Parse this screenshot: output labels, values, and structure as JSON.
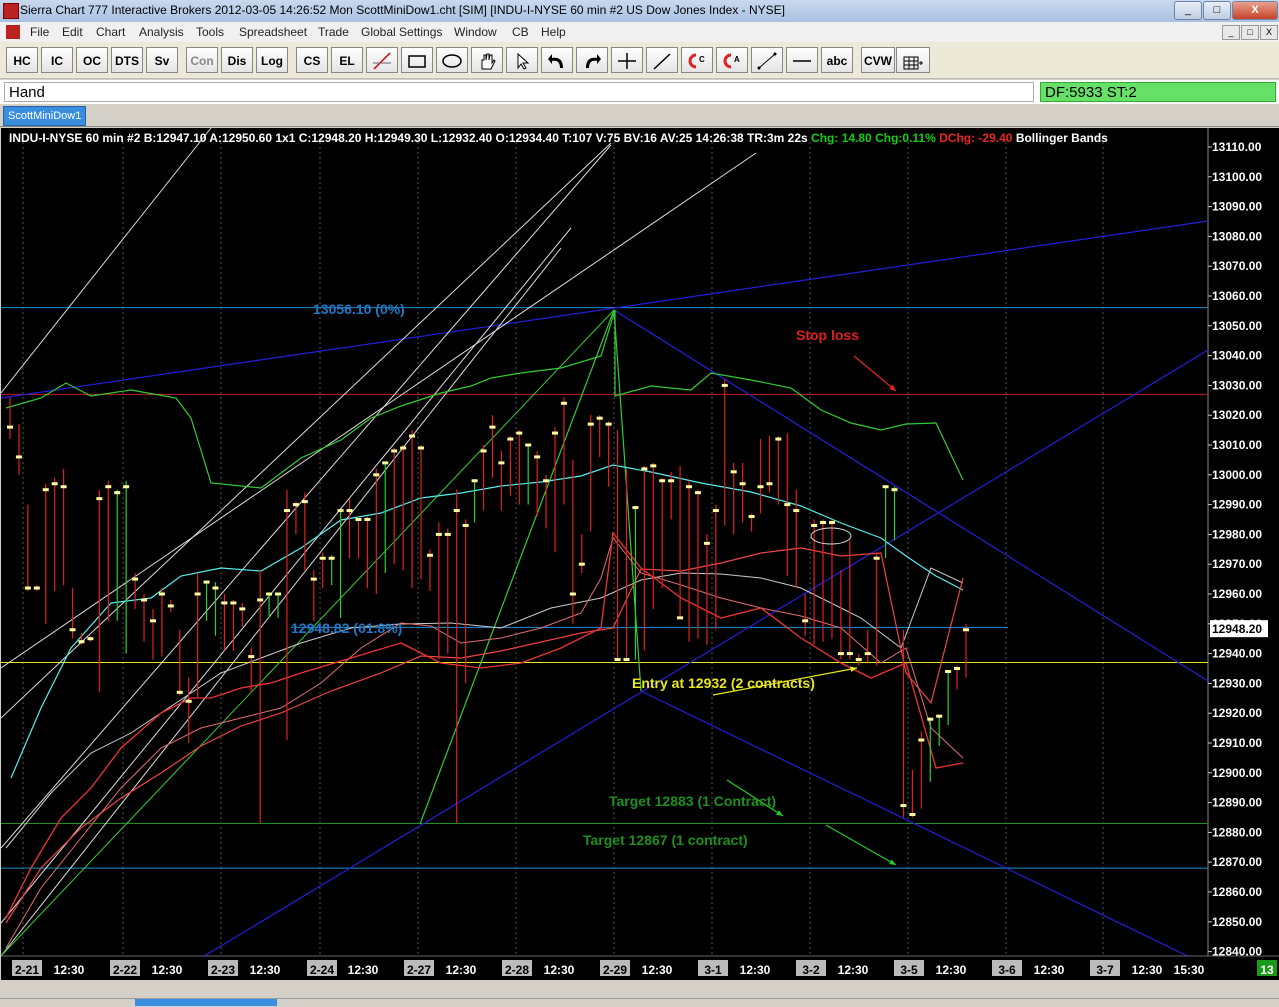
{
  "window": {
    "title": "Sierra Chart 777 Interactive Brokers 2012-03-05  14:26:52 Mon  ScottMiniDow1.cht [SIM]  [INDU-I-NYSE  60 min  #2  US Dow Jones Index - NYSE]",
    "min": "_",
    "max": "□",
    "close": "X"
  },
  "menu": [
    "File",
    "Edit",
    "Chart",
    "Analysis",
    "Tools",
    "Spreadsheet",
    "Trade",
    "Global Settings",
    "Window",
    "CB",
    "Help"
  ],
  "mdi_controls": [
    "_",
    "□",
    "X"
  ],
  "toolbar": [
    {
      "label": "HC",
      "icon": ""
    },
    {
      "label": "IC",
      "icon": ""
    },
    {
      "label": "OC",
      "icon": ""
    },
    {
      "label": "DTS",
      "icon": ""
    },
    {
      "label": "Sv",
      "icon": ""
    },
    {
      "label": "Con",
      "icon": ""
    },
    {
      "label": "Dis",
      "icon": ""
    },
    {
      "label": "Log",
      "icon": ""
    },
    {
      "label": "CS",
      "icon": ""
    },
    {
      "label": "EL",
      "icon": ""
    },
    {
      "label": "",
      "icon": "trendline-icon"
    },
    {
      "label": "",
      "icon": "rectangle-icon"
    },
    {
      "label": "",
      "icon": "ellipse-icon"
    },
    {
      "label": "",
      "icon": "hand-icon"
    },
    {
      "label": "",
      "icon": "pointer-icon"
    },
    {
      "label": "",
      "icon": "undo-arrow-icon"
    },
    {
      "label": "",
      "icon": "redo-arrow-icon"
    },
    {
      "label": "",
      "icon": "crosshair-icon"
    },
    {
      "label": "",
      "icon": "ray-icon"
    },
    {
      "label": "",
      "icon": "magnet-c-icon"
    },
    {
      "label": "",
      "icon": "magnet-a-icon"
    },
    {
      "label": "",
      "icon": "line-icon"
    },
    {
      "label": "",
      "icon": "horizontal-line-icon"
    },
    {
      "label": "abc",
      "icon": ""
    },
    {
      "label": "CVW",
      "icon": ""
    },
    {
      "label": "",
      "icon": "tvw-grid-icon"
    }
  ],
  "tool_mode": "Hand",
  "status_box": "DF:5933  ST:2",
  "chart_tab": "ScottMiniDow1",
  "info": {
    "symbol": "INDU-I-NYSE  60 min   #2 B:12947.10 A:12950.60 1x1 C:12948.20 H:12949.30 L:12932.40 O:12934.40 T:107 V:75 BV:16 AV:25 14:26:38 TR:3m 22s",
    "chg": "Chg: 14.80 Chg:0.11%",
    "dchg": "DChg: -29.40",
    "study": "Bollinger Bands"
  },
  "annotations": {
    "fib0": "13056.10 (0%)",
    "fib618": "12948.82 (61.8%)",
    "stop": "Stop loss",
    "entry": "Entry at 12932 (2 contracts)",
    "target1": "Target 12883 (1 Contract)",
    "target2": "Target 12867 (1 contract)"
  },
  "colors": {
    "background": "#000000",
    "up_bar": "#2ecc2e",
    "down_bar": "#e02020",
    "price_label": "#ffffff",
    "fib_line": "#1e90d0",
    "stop_line": "#c02020",
    "entry_line": "#e8e820",
    "target_line": "#1f8f1f",
    "trend_line": "#2020d8"
  },
  "price_axis": {
    "ticks": [
      "13110.00",
      "13100.00",
      "13090.00",
      "13080.00",
      "13070.00",
      "13060.00",
      "13050.00",
      "13040.00",
      "13030.00",
      "13020.00",
      "13010.00",
      "13000.00",
      "12990.00",
      "12980.00",
      "12970.00",
      "12960.00",
      "12950.00",
      "12940.00",
      "12930.00",
      "12920.00",
      "12910.00",
      "12900.00",
      "12890.00",
      "12880.00",
      "12870.00",
      "12860.00",
      "12850.00",
      "12840.00"
    ],
    "last_price": "12948.20"
  },
  "time_axis": {
    "labels": [
      {
        "text": "2-21",
        "date": true
      },
      {
        "text": "12:30",
        "date": false
      },
      {
        "text": "2-22",
        "date": true
      },
      {
        "text": "12:30",
        "date": false
      },
      {
        "text": "2-23",
        "date": true
      },
      {
        "text": "12:30",
        "date": false
      },
      {
        "text": "2-24",
        "date": true
      },
      {
        "text": "12:30",
        "date": false
      },
      {
        "text": "2-27",
        "date": true
      },
      {
        "text": "12:30",
        "date": false
      },
      {
        "text": "2-28",
        "date": true
      },
      {
        "text": "12:30",
        "date": false
      },
      {
        "text": "2-29",
        "date": true
      },
      {
        "text": "12:30",
        "date": false
      },
      {
        "text": "3-1",
        "date": true
      },
      {
        "text": "12:30",
        "date": false
      },
      {
        "text": "3-2",
        "date": true
      },
      {
        "text": "12:30",
        "date": false
      },
      {
        "text": "3-5",
        "date": true
      },
      {
        "text": "12:30",
        "date": false
      },
      {
        "text": "3-6",
        "date": true
      },
      {
        "text": "12:30",
        "date": false
      },
      {
        "text": "3-7",
        "date": true
      },
      {
        "text": "12:30",
        "date": false
      },
      {
        "text": "15:30",
        "date": false
      }
    ],
    "counter": "13"
  },
  "levels": {
    "fib0": 13056.1,
    "stop": 13027,
    "fib618": 12948.82,
    "entry": 12937,
    "target1": 12883,
    "target2": 12868
  },
  "bars": [
    [
      13026,
      13012,
      13024,
      13016
    ],
    [
      13017,
      13000,
      13016,
      13006
    ],
    [
      12990,
      12961,
      12988,
      12962
    ],
    [
      12963,
      12961,
      12962,
      12962
    ],
    [
      12997,
      12950,
      12994,
      12995
    ],
    [
      12999,
      12961,
      12996,
      12997
    ],
    [
      13002,
      12963,
      12995,
      12996
    ],
    [
      12962,
      12945,
      12961,
      12948
    ],
    [
      12947,
      12943,
      12946,
      12944
    ],
    [
      12946,
      12944,
      12945,
      12945
    ],
    [
      12995,
      12927,
      12988,
      12992
    ],
    [
      12998,
      12951,
      12995,
      12996
    ],
    [
      12992,
      12951,
      12995,
      12994
    ],
    [
      12994,
      12940,
      12998,
      12996
    ],
    [
      12967,
      12955,
      12965,
      12965
    ],
    [
      12960,
      12944,
      12959,
      12958
    ],
    [
      12955,
      12938,
      12952,
      12951
    ],
    [
      12962,
      12939,
      12960,
      12960
    ],
    [
      12958,
      12954,
      12957,
      12956
    ],
    [
      12948,
      12926,
      12946,
      12927
    ],
    [
      12932,
      12910,
      12928,
      12924
    ],
    [
      12967,
      12925,
      12950,
      12960
    ],
    [
      12963,
      12951,
      12963,
      12964
    ],
    [
      12962,
      12946,
      12964,
      12962
    ],
    [
      12960,
      12941,
      12959,
      12957
    ],
    [
      12958,
      12941,
      12957,
      12957
    ],
    [
      12957,
      12949,
      12956,
      12955
    ],
    [
      12942,
      12927,
      12940,
      12939
    ],
    [
      12968,
      12883,
      12932,
      12958
    ],
    [
      12960,
      12952,
      12959,
      12960
    ],
    [
      12959,
      12952,
      12960,
      12960
    ],
    [
      12995,
      12911,
      12958,
      12988
    ],
    [
      12991,
      12980,
      12988,
      12990
    ],
    [
      12994,
      12968,
      12993,
      12991
    ],
    [
      12968,
      12951,
      12966,
      12965
    ],
    [
      12974,
      12962,
      12970,
      12972
    ],
    [
      12971,
      12963,
      12973,
      12972
    ],
    [
      12987,
      12952,
      12985,
      12988
    ],
    [
      12992,
      12972,
      12990,
      12988
    ],
    [
      12986,
      12972,
      12984,
      12985
    ],
    [
      12986,
      12962,
      12983,
      12985
    ],
    [
      13002,
      12960,
      12986,
      13000
    ],
    [
      13004,
      12967,
      13003,
      13004
    ],
    [
      13009,
      12970,
      13007,
      13008
    ],
    [
      13010,
      12968,
      13006,
      13009
    ],
    [
      13015,
      12962,
      13012,
      13013
    ],
    [
      13010,
      12965,
      13008,
      13009
    ],
    [
      12975,
      12961,
      12972,
      12973
    ],
    [
      12984,
      12938,
      12981,
      12980
    ],
    [
      12982,
      12940,
      12979,
      12980
    ],
    [
      12995,
      12883,
      12914,
      12988
    ],
    [
      12985,
      12930,
      12940,
      12983
    ],
    [
      12998,
      12984,
      12996,
      12998
    ],
    [
      13010,
      12988,
      13005,
      13008
    ],
    [
      13020,
      12999,
      13012,
      13016
    ],
    [
      13008,
      12988,
      13006,
      13004
    ],
    [
      13013,
      12993,
      13012,
      13012
    ],
    [
      13015,
      12990,
      13014,
      13014
    ],
    [
      13010,
      12990,
      13009,
      13010
    ],
    [
      13008,
      12986,
      13005,
      13006
    ],
    [
      13000,
      12982,
      12995,
      12998
    ],
    [
      13016,
      12974,
      12995,
      13014
    ],
    [
      13026,
      12990,
      13022,
      13024
    ],
    [
      13005,
      12950,
      13002,
      12960
    ],
    [
      12980,
      12967,
      12978,
      12970
    ],
    [
      13020,
      12981,
      13010,
      13017
    ],
    [
      13020,
      13006,
      13018,
      13019
    ],
    [
      13018,
      12996,
      13014,
      13017
    ],
    [
      13015,
      12939,
      13015,
      12938
    ],
    [
      13002,
      12938,
      13000,
      12938
    ],
    [
      12989,
      12938,
      12987,
      12989
    ],
    [
      13003,
      12941,
      13000,
      13002
    ],
    [
      13004,
      12955,
      13002,
      13003
    ],
    [
      12999,
      12962,
      12997,
      12998
    ],
    [
      13001,
      12985,
      12995,
      12998
    ],
    [
      13003,
      12952,
      12999,
      12952
    ],
    [
      12998,
      12944,
      12995,
      12996
    ],
    [
      12995,
      12945,
      12993,
      12994
    ],
    [
      12980,
      12943,
      12978,
      12977
    ],
    [
      12990,
      12948,
      12983,
      12988
    ],
    [
      13032,
      12983,
      13002,
      13030
    ],
    [
      13004,
      12980,
      13003,
      13001
    ],
    [
      13004,
      12984,
      12996,
      12997
    ],
    [
      12987,
      12981,
      12986,
      12986
    ],
    [
      13012,
      12987,
      12993,
      12996
    ],
    [
      13013,
      12994,
      12996,
      12997
    ],
    [
      13013,
      12990,
      13011,
      13012
    ],
    [
      13014,
      12966,
      13014,
      12990
    ],
    [
      12995,
      12962,
      12990,
      12988
    ],
    [
      12960,
      12946,
      12950,
      12951
    ],
    [
      12985,
      12943,
      12980,
      12983
    ],
    [
      12985,
      12944,
      12983,
      12984
    ],
    [
      12985,
      12945,
      12980,
      12984
    ],
    [
      12968,
      12938,
      12950,
      12940
    ],
    [
      12978,
      12938,
      12955,
      12940
    ],
    [
      12940,
      12936,
      12937,
      12938
    ],
    [
      12948,
      12937,
      12939,
      12940
    ],
    [
      12974,
      12936,
      12940,
      12972
    ],
    [
      12996,
      12972,
      12995,
      12996
    ],
    [
      12995,
      12978,
      12996,
      12995
    ],
    [
      12948,
      12885,
      12947,
      12889
    ],
    [
      12901,
      12885,
      12889,
      12886
    ],
    [
      12914,
      12888,
      12913,
      12911
    ],
    [
      12918,
      12897,
      12917,
      12918
    ],
    [
      12919,
      12909,
      12918,
      12919
    ],
    [
      12934,
      12916,
      12932,
      12934
    ],
    [
      12936,
      12928,
      12935,
      12935
    ],
    [
      12950,
      12932,
      12934,
      12948
    ]
  ]
}
